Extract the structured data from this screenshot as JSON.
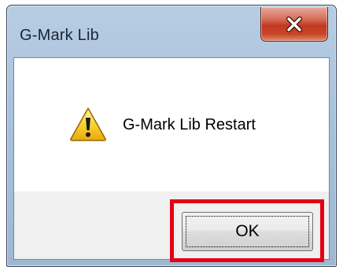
{
  "window": {
    "title": "G-Mark Lib",
    "close_icon": "close-icon"
  },
  "message": {
    "icon": "warning-icon",
    "text": "G-Mark Lib Restart"
  },
  "buttons": {
    "ok_label": "OK"
  },
  "colors": {
    "highlight": "#e60012",
    "close_button": "#c2391f",
    "titlebar": "#a9c2db"
  }
}
